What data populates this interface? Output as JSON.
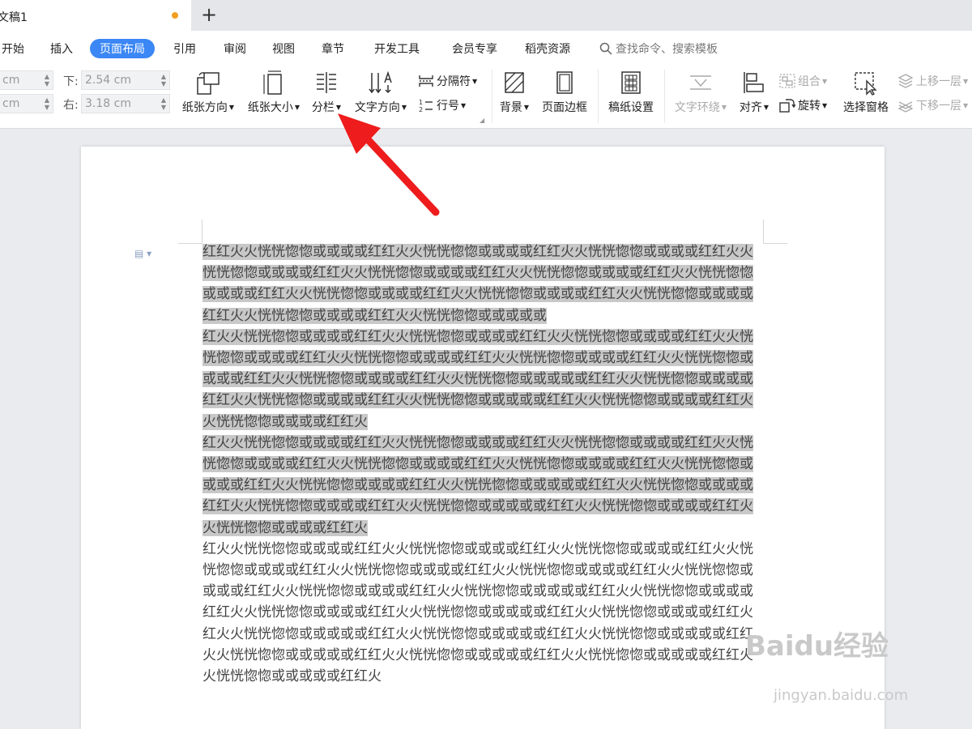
{
  "tab": {
    "title": "文稿1",
    "new_tab": "+"
  },
  "menu": {
    "items": [
      "开始",
      "插入",
      "页面布局",
      "引用",
      "审阅",
      "视图",
      "章节",
      "开发工具",
      "会员专享",
      "稻壳资源"
    ],
    "active_index": 2,
    "search": "查找命令、搜索模板"
  },
  "margins": {
    "top_value": "cm",
    "left_value": "cm",
    "bottom_label": "下:",
    "bottom_value": "2.54 cm",
    "right_label": "右:",
    "right_value": "3.18 cm"
  },
  "ribbon": {
    "orientation": "纸张方向",
    "size": "纸张大小",
    "columns": "分栏",
    "text_direction": "文字方向",
    "separator": "分隔符",
    "line_number": "行号",
    "background": "背景",
    "page_border": "页面边框",
    "manuscript": "稿纸设置",
    "text_wrap": "文字环绕",
    "align": "对齐",
    "group": "组合",
    "rotate": "旋转",
    "select_pane": "选择窗格",
    "bring_forward": "上移一层",
    "send_backward": "下移一层"
  },
  "document": {
    "paragraphs": [
      {
        "selected": true,
        "text": "红红火火恍恍惚惚或或或或红红火火恍恍惚惚或或或或红红火火恍恍惚惚或或或或红红火火恍恍惚惚或或或或红红火火恍恍惚惚或或或或红红火火恍恍惚惚或或或或红红火火恍恍惚惚或或或或红红火火恍恍惚惚或或或或红红火火恍恍惚惚或或或或红红火火恍恍惚惚或或或或红红火火恍恍惚惚或或或或红红火火恍恍惚惚或或或或或"
      },
      {
        "selected": true,
        "text": "红火火恍恍惚惚或或或或红红火火恍恍惚惚或或或或红红火火恍恍惚惚或或或或红红火火恍恍惚惚或或或或红红火火恍恍惚惚或或或或红红火火恍恍惚惚或或或或红红火火恍恍惚惚或或或或红红火火恍恍惚惚或或或或红红火火恍恍惚惚或或或或或红红火火恍恍惚惚或或或或红红火火恍恍惚惚或或或或红红火火恍恍惚惚或或或或或红红火火恍恍惚惚或或或或红红火火恍恍惚惚或或或或红红火"
      },
      {
        "selected": true,
        "text": "红火火恍恍惚惚或或或或红红火火恍恍惚惚或或或或红红火火恍恍惚惚或或或或红红火火恍恍惚惚或或或或红红火火恍恍惚惚或或或或红红火火恍恍惚惚或或或或红红火火恍恍惚惚或或或或红红火火恍恍惚惚或或或或红红火火恍恍惚惚或或或或或红红火火恍恍惚惚或或或或红红火火恍恍惚惚或或或或红红火火恍恍惚惚或或或或或红红火火恍恍惚惚或或或或红红火火恍恍惚惚或或或或红红火"
      },
      {
        "selected": false,
        "text": "红火火恍恍惚惚或或或或红红火火恍恍惚惚或或或或红红火火恍恍惚惚或或或或红红火火恍恍惚惚或或或或红红火火恍恍惚惚或或或或红红火火恍恍惚惚或或或或红红火火恍恍惚惚或或或或红红火火恍恍惚惚或或或或红红火火恍恍惚惚或或或或或红红火火恍恍惚惚或或或或红红火火恍恍惚惚或或或或红红火火恍恍惚惚或或或或或红红火火恍恍惚惚或或或或红红火红火火恍恍惚惚或或或或或红红火火恍恍惚惚或或或或或红红火火恍恍惚惚或或或或或红红火火恍恍惚惚或或或或或红红火火恍恍惚惚或或或或或红红火火恍恍惚惚或或或或或红红火火恍恍惚惚或或或或或红红火"
      }
    ]
  },
  "watermark": {
    "brand": "Baidu经验",
    "url": "jingyan.baidu.com"
  },
  "colors": {
    "accent": "#3b87f5",
    "arrow": "#ee1c1c",
    "selection": "#c8c8c8",
    "modified_dot": "#f0a020"
  }
}
